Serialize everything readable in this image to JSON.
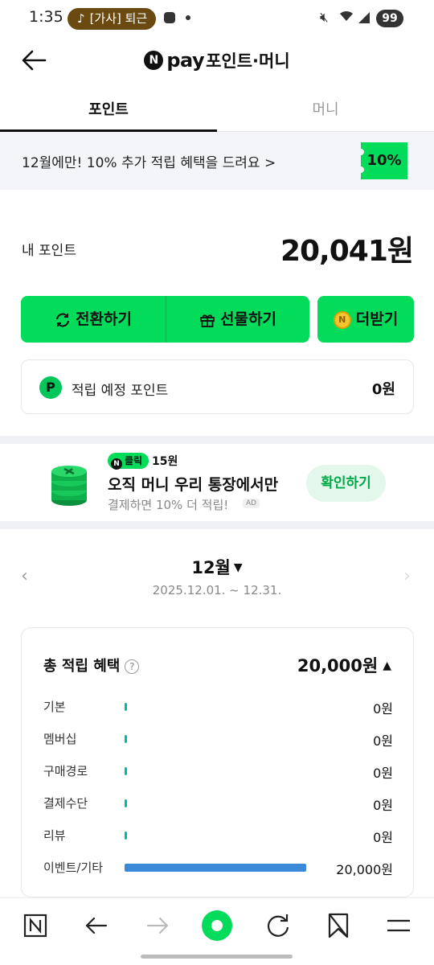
{
  "status_bar": {
    "time": "1:35",
    "media_pill": "[가사] 퇴근",
    "battery": "99"
  },
  "header": {
    "logo_n": "N",
    "logo_pay": "pay",
    "title": "포인트·머니"
  },
  "tabs": [
    {
      "label": "포인트",
      "active": true
    },
    {
      "label": "머니",
      "active": false
    }
  ],
  "promo": {
    "text": "12월에만! 10% 추가 적립 혜택을 드려요",
    "chevron": ">",
    "badge": "10%"
  },
  "my_point": {
    "label": "내 포인트",
    "value": "20,041원"
  },
  "actions": {
    "convert": "전환하기",
    "gift": "선물하기",
    "more": "더받기"
  },
  "pending": {
    "icon": "P",
    "label": "적립 예정 포인트",
    "value": "0원"
  },
  "ad": {
    "tag": "클릭",
    "tag_n": "N",
    "reward": "15원",
    "headline": "오직 머니 우리 통장에서만",
    "sub": "결제하면 10% 더 적립!",
    "ad_label": "AD",
    "cta": "확인하기"
  },
  "period": {
    "month": "12월",
    "range": "2025.12.01. ~ 12.31."
  },
  "summary": {
    "title": "총 적립 혜택",
    "help": "?",
    "total": "20,000원",
    "rows": [
      {
        "label": "기본",
        "value": "0원",
        "amount": 0
      },
      {
        "label": "멤버십",
        "value": "0원",
        "amount": 0
      },
      {
        "label": "구매경로",
        "value": "0원",
        "amount": 0
      },
      {
        "label": "결제수단",
        "value": "0원",
        "amount": 0
      },
      {
        "label": "리뷰",
        "value": "0원",
        "amount": 0
      },
      {
        "label": "이벤트/기타",
        "value": "20,000원",
        "amount": 20000
      }
    ]
  },
  "colors": {
    "brand_green": "#03db5a",
    "bar_teal": "#00b6b4",
    "bar_blue": "#3b8ad9"
  },
  "icons": {
    "bottom_nav": [
      "naver-home-icon",
      "back-arrow-icon",
      "forward-arrow-icon",
      "green-dot-icon",
      "refresh-icon",
      "bookmark-icon",
      "menu-icon"
    ]
  }
}
